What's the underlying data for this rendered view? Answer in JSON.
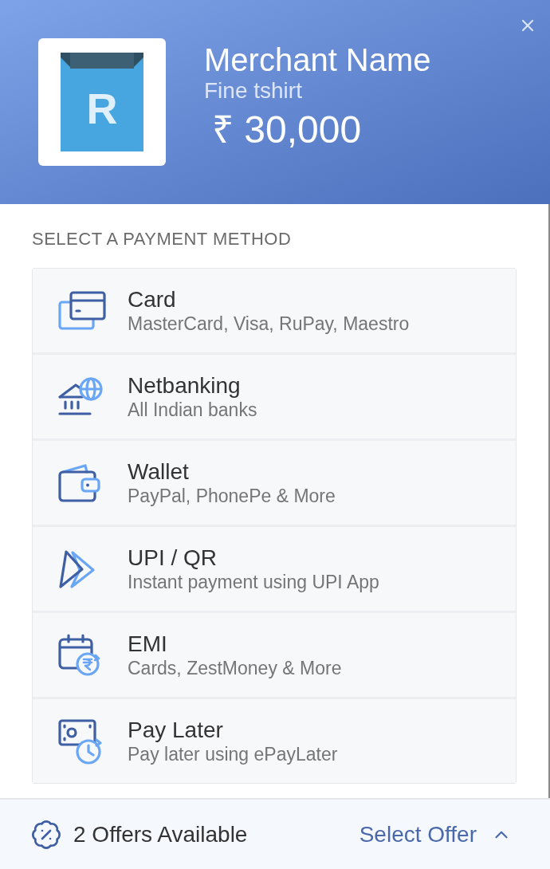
{
  "header": {
    "logo": {
      "letter": "R"
    },
    "merchant_name": "Merchant Name",
    "product": "Fine tshirt",
    "amount": "₹ 30,000"
  },
  "section_title": "SELECT A PAYMENT METHOD",
  "methods": [
    {
      "kind": "card",
      "title": "Card",
      "subtitle": "MasterCard, Visa, RuPay, Maestro"
    },
    {
      "kind": "netbanking",
      "title": "Netbanking",
      "subtitle": "All Indian banks"
    },
    {
      "kind": "wallet",
      "title": "Wallet",
      "subtitle": "PayPal, PhonePe & More"
    },
    {
      "kind": "upi",
      "title": "UPI / QR",
      "subtitle": "Instant payment using UPI App"
    },
    {
      "kind": "emi",
      "title": "EMI",
      "subtitle": "Cards, ZestMoney & More"
    },
    {
      "kind": "paylater",
      "title": "Pay Later",
      "subtitle": "Pay later using ePayLater"
    }
  ],
  "footer": {
    "offers": "2 Offers Available",
    "action": "Select Offer"
  }
}
